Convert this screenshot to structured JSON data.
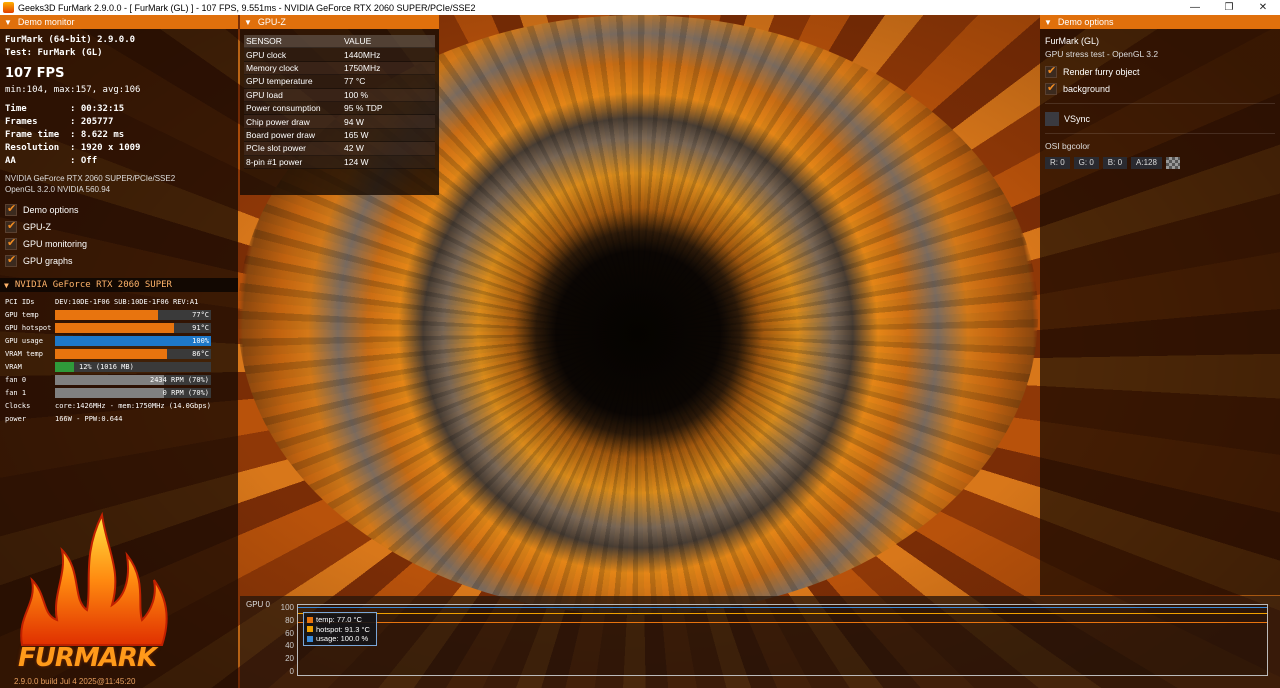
{
  "window": {
    "title": "Geeks3D FurMark 2.9.0.0 - [ FurMark (GL) ] - 107 FPS, 9.551ms - NVIDIA GeForce RTX 2060 SUPER/PCIe/SSE2",
    "minimize": "—",
    "maximize": "❐",
    "close": "✕"
  },
  "demo_monitor": {
    "header": "Demo monitor",
    "app_line": "FurMark (64-bit) 2.9.0.0",
    "test_line": "Test: FurMark (GL)",
    "fps": "107 FPS",
    "minmax": "min:104, max:157, avg:106",
    "stats": [
      "Time        : 00:32:15",
      "Frames      : 205777",
      "Frame time  : 8.622 ms",
      "Resolution  : 1920 x 1009",
      "AA          : Off"
    ],
    "gpu_name": "NVIDIA GeForce RTX 2060 SUPER/PCIe/SSE2",
    "gl_version": "OpenGL 3.2.0 NVIDIA 560.94",
    "checks": [
      {
        "label": "Demo options",
        "checked": true
      },
      {
        "label": "GPU-Z",
        "checked": true
      },
      {
        "label": "GPU monitoring",
        "checked": true
      },
      {
        "label": "GPU graphs",
        "checked": true
      }
    ]
  },
  "gpu_monitor": {
    "header": "NVIDIA GeForce RTX 2060 SUPER",
    "pci_label": "PCI IDs",
    "pci_value": "DEV:10DE-1F06 SUB:10DE-1F06 REV:A1",
    "bars": [
      {
        "label": "GPU temp",
        "value": "77°C",
        "fraction": 0.66,
        "color": "#e8740e"
      },
      {
        "label": "GPU hotspot",
        "value": "91°C",
        "fraction": 0.76,
        "color": "#e8740e"
      },
      {
        "label": "GPU usage",
        "value": "100%",
        "fraction": 1.0,
        "color": "#1e78c8"
      },
      {
        "label": "VRAM temp",
        "value": "86°C",
        "fraction": 0.72,
        "color": "#e8740e"
      },
      {
        "label": "VRAM",
        "value": "12% (1016 MB)",
        "fraction": 0.12,
        "color": "#2f9a3a",
        "left": true
      },
      {
        "label": "fan 0",
        "value": "2434 RPM (70%)",
        "fraction": 0.7,
        "color": "#808080"
      },
      {
        "label": "fan 1",
        "value": "0 RPM (70%)",
        "fraction": 0.7,
        "color": "#808080"
      }
    ],
    "clocks_label": "Clocks",
    "clocks_value": "core:1426MHz - mem:1750MHz (14.0Gbps)",
    "power_label": "power",
    "power_value": "166W - PPW:0.644"
  },
  "logo": {
    "text": "FURMARK",
    "build": "2.9.0.0 build Jul  4 2025@11:45:20"
  },
  "gpuz": {
    "header": "GPU-Z",
    "col_sensor": "SENSOR",
    "col_value": "VALUE",
    "rows": [
      {
        "sensor": "GPU clock",
        "value": "1440MHz"
      },
      {
        "sensor": "Memory clock",
        "value": "1750MHz"
      },
      {
        "sensor": "GPU temperature",
        "value": "77 °C"
      },
      {
        "sensor": "GPU load",
        "value": "100 %"
      },
      {
        "sensor": "Power consumption",
        "value": "95 % TDP"
      },
      {
        "sensor": "Chip power draw",
        "value": "94 W"
      },
      {
        "sensor": "Board power draw",
        "value": "165 W"
      },
      {
        "sensor": "PCIe slot power",
        "value": "42 W"
      },
      {
        "sensor": "8-pin #1 power",
        "value": "124 W"
      }
    ]
  },
  "demo_options": {
    "header": "Demo options",
    "renderer": "FurMark (GL)",
    "subtitle": "GPU stress test - OpenGL 3.2",
    "render_furry": "Render furry object",
    "background": "background",
    "vsync": "VSync",
    "osi_label": "OSI bgcolor",
    "osi": {
      "r": "R: 0",
      "g": "G: 0",
      "b": "B: 0",
      "a": "A:128"
    }
  },
  "graph": {
    "label": "GPU 0",
    "y_ticks": [
      "100",
      "80",
      "60",
      "40",
      "20",
      "0"
    ],
    "legend": [
      {
        "label": "temp: 77.0 °C",
        "color": "#e8740e",
        "value": 77.0
      },
      {
        "label": "hotspot: 91.3 °C",
        "color": "#f0a000",
        "value": 91.3
      },
      {
        "label": "usage: 100.0 %",
        "color": "#3a8ad8",
        "value": 100.0
      }
    ]
  }
}
